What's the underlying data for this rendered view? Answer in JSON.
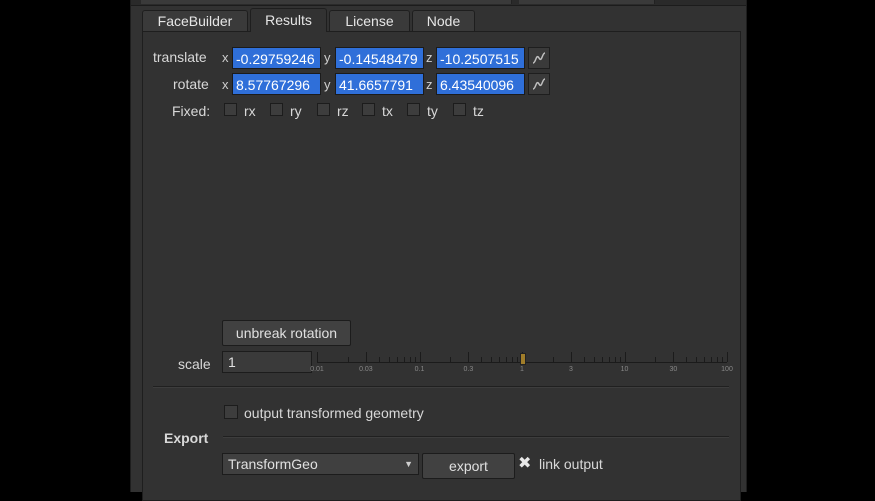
{
  "tabs": [
    {
      "label": "FaceBuilder"
    },
    {
      "label": "Results"
    },
    {
      "label": "License"
    },
    {
      "label": "Node"
    }
  ],
  "translate": {
    "label": "translate",
    "x_label": "x",
    "y_label": "y",
    "z_label": "z",
    "x": "-0.29759246",
    "y": "-0.14548479",
    "z": "-10.2507515"
  },
  "rotate": {
    "label": "rotate",
    "x_label": "x",
    "y_label": "y",
    "z_label": "z",
    "x": "8.57767296",
    "y": "41.6657791",
    "z": "6.43540096"
  },
  "fixed": {
    "label": "Fixed:",
    "items": [
      {
        "label": "rx",
        "checked": false
      },
      {
        "label": "ry",
        "checked": false
      },
      {
        "label": "rz",
        "checked": false
      },
      {
        "label": "tx",
        "checked": false
      },
      {
        "label": "ty",
        "checked": false
      },
      {
        "label": "tz",
        "checked": false
      }
    ]
  },
  "unbreak_rotation": "unbreak rotation",
  "scale": {
    "label": "scale",
    "value": "1",
    "ticks": [
      "0.01",
      "0.03",
      "0.1",
      "0.3",
      "1",
      "3",
      "10",
      "30",
      "100"
    ]
  },
  "output_transformed_geometry": {
    "label": "output transformed geometry",
    "checked": false
  },
  "export": {
    "section_label": "Export",
    "selected": "TransformGeo",
    "button": "export",
    "link_output": {
      "label": "link output",
      "checked": true
    }
  },
  "icons": {
    "anim": "curve-icon",
    "caret": "dropdown-caret-icon",
    "check": "checkmark-icon"
  },
  "colors": {
    "value_highlight": "#2f6fd9",
    "panel": "#323232",
    "handle": "#a07d2a"
  }
}
